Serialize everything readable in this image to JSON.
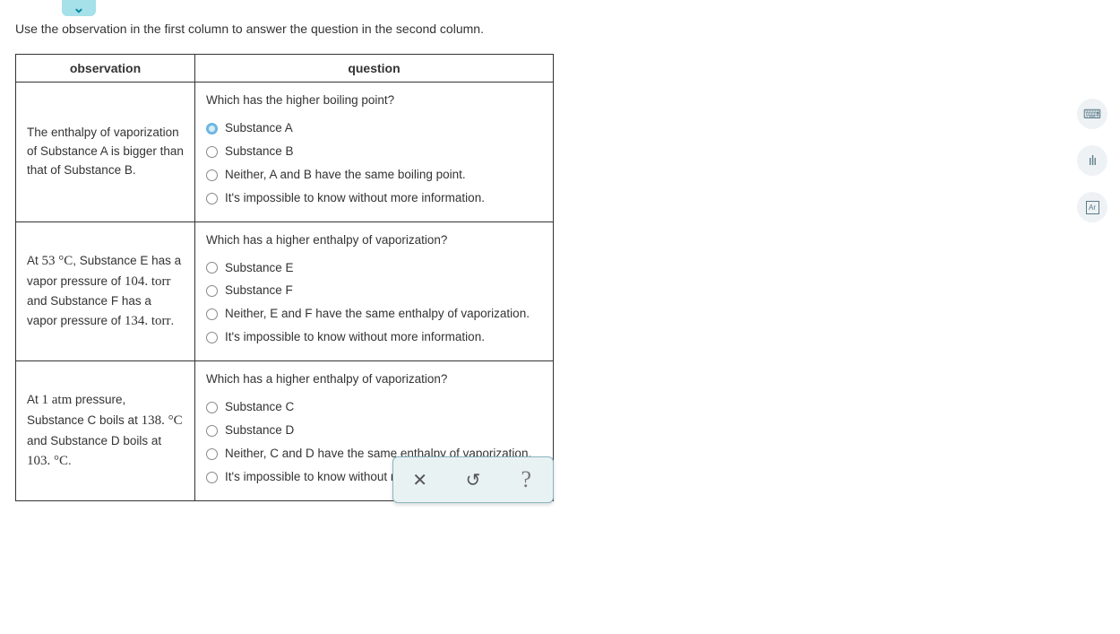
{
  "chevron_glyph": "⌄",
  "instruction": "Use the observation in the first column to answer the question in the second column.",
  "headers": {
    "obs": "observation",
    "quest": "question"
  },
  "rows": [
    {
      "obs_plain": "The enthalpy of vaporization of Substance A is bigger than that of Substance B.",
      "prompt": "Which has the higher boiling point?",
      "opts": [
        "Substance A",
        "Substance B",
        "Neither, A and B have the same boiling point.",
        "It's impossible to know without more information."
      ],
      "selected": 0
    },
    {
      "obs_pre": "At ",
      "obs_num1": "53 °C",
      "obs_mid1": ", Substance E has a vapor pressure of ",
      "obs_num2": "104. torr",
      "obs_mid2": " and Substance F has a vapor pressure of ",
      "obs_num3": "134. torr",
      "obs_post": ".",
      "prompt": "Which has a higher enthalpy of vaporization?",
      "opts": [
        "Substance E",
        "Substance F",
        "Neither, E and F have the same enthalpy of vaporization.",
        "It's impossible to know without more information."
      ],
      "selected": -1
    },
    {
      "obs_pre": "At ",
      "obs_num1": "1 atm",
      "obs_mid1": " pressure, Substance C boils at ",
      "obs_num2": "138. °C",
      "obs_mid2": " and Substance D boils at ",
      "obs_num3": "103. °C",
      "obs_post": ".",
      "prompt": "Which has a higher enthalpy of vaporization?",
      "opts": [
        "Substance C",
        "Substance D",
        "Neither, C and D have the same enthalpy of vaporization.",
        "It's impossible to know without more information."
      ],
      "selected": -1
    }
  ],
  "actions": {
    "x": "✕",
    "undo": "↺",
    "help": "?"
  },
  "tools": {
    "calc": "⌨",
    "bars": "ılı",
    "periodic": "Ar"
  }
}
